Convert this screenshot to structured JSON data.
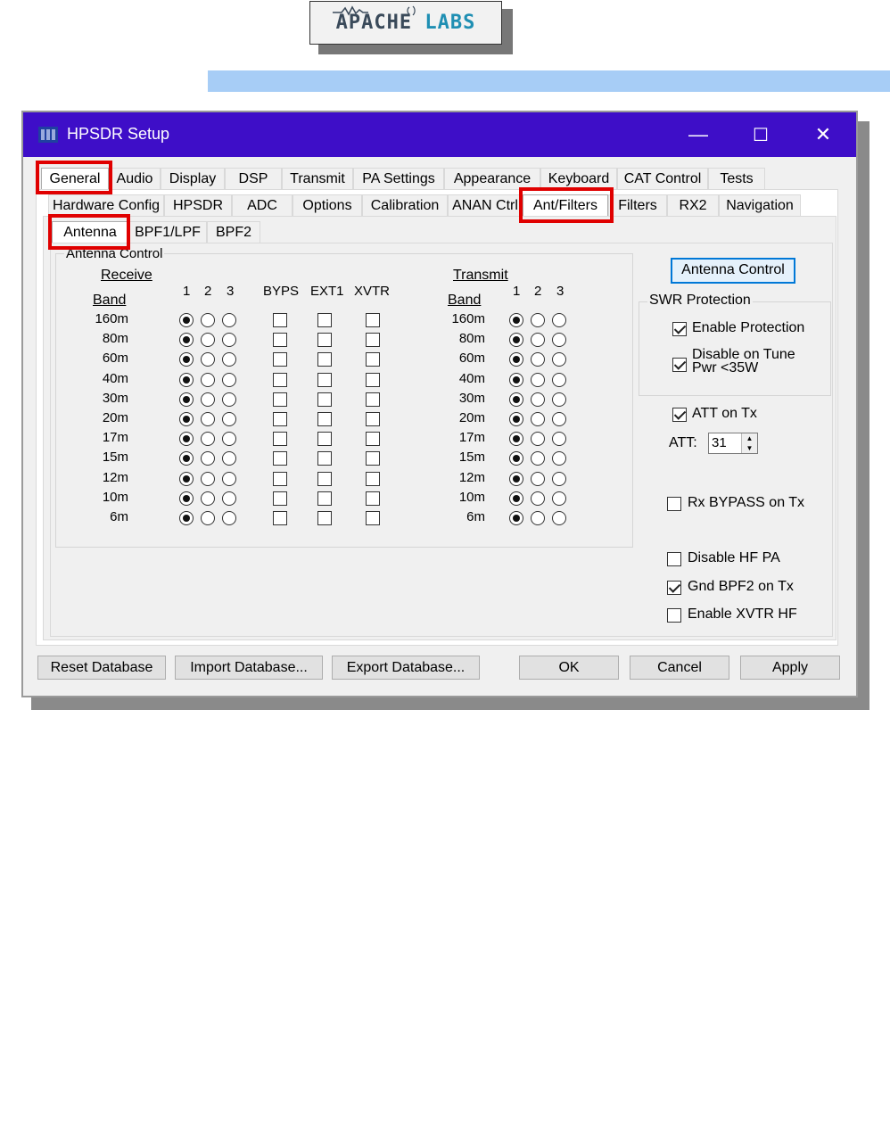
{
  "logo": {
    "word1": "APACHE",
    "word2": "LABS"
  },
  "window": {
    "title": "HPSDR Setup",
    "minimize": "—",
    "maximize": "☐",
    "close": "✕"
  },
  "tabs_top": [
    "General",
    "Audio",
    "Display",
    "DSP",
    "Transmit",
    "PA Settings",
    "Appearance",
    "Keyboard",
    "CAT Control",
    "Tests"
  ],
  "tabs_second": [
    "Hardware Config",
    "HPSDR",
    "ADC",
    "Options",
    "Calibration",
    "ANAN Ctrl",
    "Ant/Filters",
    "Filters",
    "RX2",
    "Navigation"
  ],
  "tabs_third": [
    "Antenna",
    "BPF1/LPF",
    "BPF2"
  ],
  "antenna_group": {
    "title": "Antenna Control",
    "receive_label": "Receive",
    "transmit_label": "Transmit",
    "band_label": "Band",
    "ant_cols": [
      "1",
      "2",
      "3"
    ],
    "extra_cols": [
      "BYPS",
      "EXT1",
      "XVTR"
    ],
    "bands": [
      "160m",
      "80m",
      "60m",
      "40m",
      "30m",
      "20m",
      "17m",
      "15m",
      "12m",
      "10m",
      "6m"
    ],
    "rx_selected": 1,
    "tx_selected": 1
  },
  "antenna_control_button": "Antenna Control",
  "swr": {
    "title": "SWR Protection",
    "enable_protection": "Enable Protection",
    "disable_on_tune_line1": "Disable on Tune",
    "disable_on_tune_line2": "Pwr <35W"
  },
  "att_on_tx": "ATT on Tx",
  "att_label": "ATT:",
  "att_value": "31",
  "rx_bypass": "Rx BYPASS on Tx",
  "disable_hf_pa": "Disable HF PA",
  "gnd_bpf2": "Gnd BPF2 on Tx",
  "enable_xvtr_hf": "Enable XVTR HF",
  "buttons": {
    "reset": "Reset Database",
    "import": "Import Database...",
    "export": "Export Database...",
    "ok": "OK",
    "cancel": "Cancel",
    "apply": "Apply"
  },
  "colors": {
    "titlebar": "#3e0ec8",
    "highlight": "#e00000",
    "banner": "#a7cdf6"
  }
}
